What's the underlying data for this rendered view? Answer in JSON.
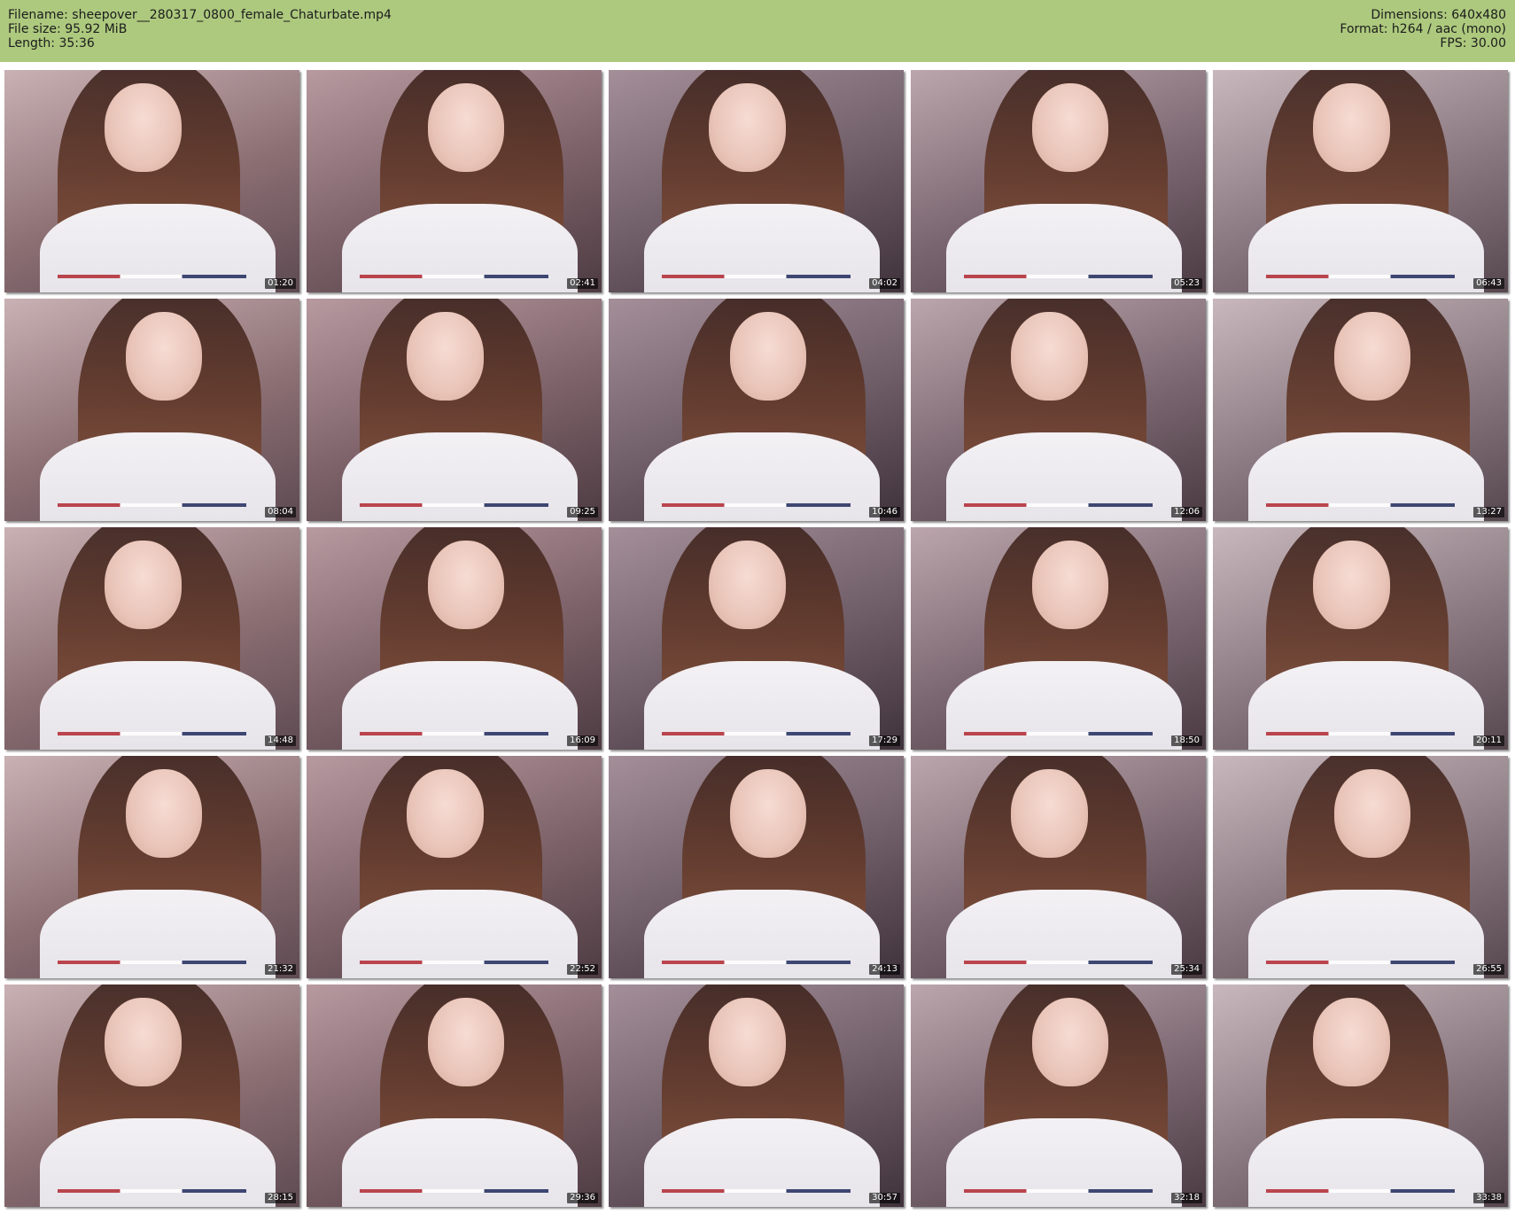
{
  "header": {
    "filename_line": "Filename: sheepover__280317_0800_female_Chaturbate.mp4",
    "filesize_line": "File size: 95.92 MiB",
    "length_line": "Length: 35:36",
    "dimensions_line": "Dimensions: 640x480",
    "format_line": "Format: h264 / aac (mono)",
    "fps_line": "FPS: 30.00",
    "background_color": "#adc97e"
  },
  "thumbnails": [
    {
      "timestamp": "01:20"
    },
    {
      "timestamp": "02:41"
    },
    {
      "timestamp": "04:02"
    },
    {
      "timestamp": "05:23"
    },
    {
      "timestamp": "06:43"
    },
    {
      "timestamp": "08:04"
    },
    {
      "timestamp": "09:25"
    },
    {
      "timestamp": "10:46"
    },
    {
      "timestamp": "12:06"
    },
    {
      "timestamp": "13:27"
    },
    {
      "timestamp": "14:48"
    },
    {
      "timestamp": "16:09"
    },
    {
      "timestamp": "17:29"
    },
    {
      "timestamp": "18:50"
    },
    {
      "timestamp": "20:11"
    },
    {
      "timestamp": "21:32"
    },
    {
      "timestamp": "22:52"
    },
    {
      "timestamp": "24:13"
    },
    {
      "timestamp": "25:34"
    },
    {
      "timestamp": "26:55"
    },
    {
      "timestamp": "28:15"
    },
    {
      "timestamp": "29:36"
    },
    {
      "timestamp": "30:57"
    },
    {
      "timestamp": "32:18"
    },
    {
      "timestamp": "33:38"
    }
  ]
}
